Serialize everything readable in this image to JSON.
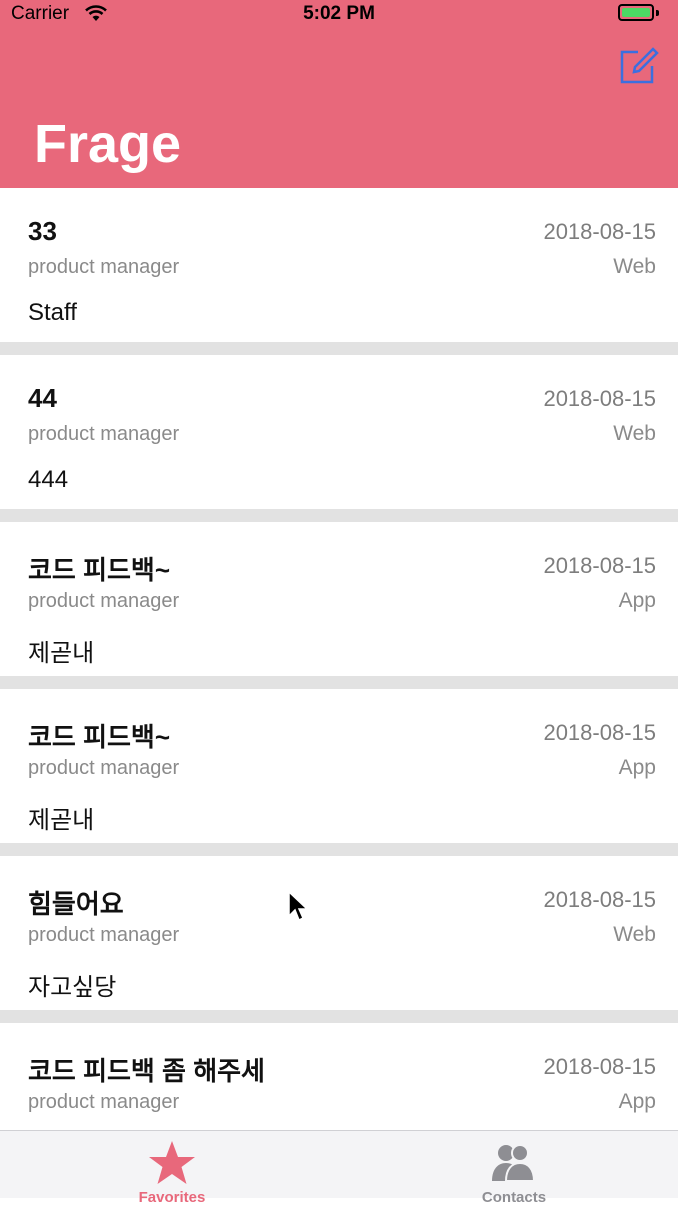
{
  "status_bar": {
    "carrier": "Carrier",
    "time": "5:02 PM"
  },
  "header": {
    "title": "Frage",
    "compose_icon": "compose-icon"
  },
  "colors": {
    "accent": "#e8687b",
    "header_bg": "#e8687b",
    "battery": "#4cd964",
    "compose": "#3b6fe0"
  },
  "posts": [
    {
      "title": "33",
      "date": "2018-08-15",
      "role": "product manager",
      "platform": "Web",
      "body": "Staff"
    },
    {
      "title": "44",
      "date": "2018-08-15",
      "role": "product manager",
      "platform": "Web",
      "body": "444"
    },
    {
      "title": "코드 피드백~",
      "date": "2018-08-15",
      "role": "product manager",
      "platform": "App",
      "body": "제곧내"
    },
    {
      "title": "코드 피드백~",
      "date": "2018-08-15",
      "role": "product manager",
      "platform": "App",
      "body": "제곧내"
    },
    {
      "title": "힘들어요",
      "date": "2018-08-15",
      "role": "product manager",
      "platform": "Web",
      "body": "자고싶당"
    },
    {
      "title": "코드 피드백 좀 해주세",
      "date": "2018-08-15",
      "role": "product manager",
      "platform": "App",
      "body": ""
    }
  ],
  "tabbar": {
    "tabs": [
      {
        "label": "Favorites",
        "icon": "star-icon",
        "active": true
      },
      {
        "label": "Contacts",
        "icon": "contacts-icon",
        "active": false
      }
    ]
  }
}
